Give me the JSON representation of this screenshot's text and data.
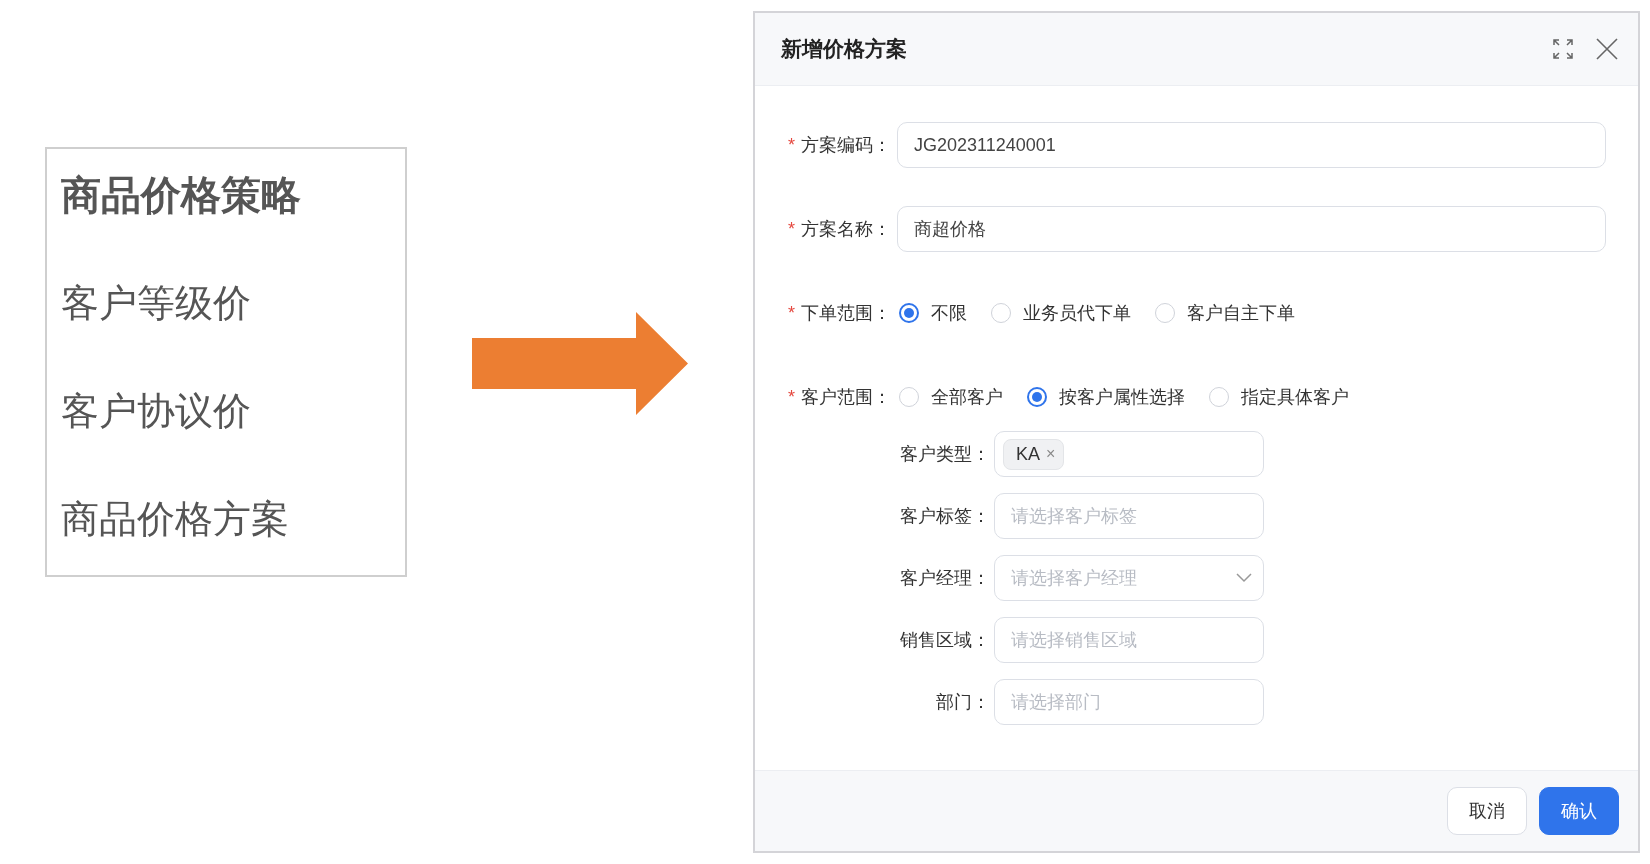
{
  "strategy_panel": {
    "title": "商品价格策略",
    "items": [
      "客户等级价",
      "客户协议价",
      "商品价格方案"
    ]
  },
  "dialog": {
    "title": "新增价格方案",
    "fields": [
      {
        "kind": "text",
        "required_mark": "*",
        "label": "方案编码：",
        "value": "JG202311240001"
      },
      {
        "kind": "text",
        "required_mark": "*",
        "label": "方案名称：",
        "value": "商超价格"
      },
      {
        "kind": "radio",
        "required_mark": "*",
        "label": "下单范围：",
        "options": [
          {
            "label": "不限",
            "selected": true
          },
          {
            "label": "业务员代下单",
            "selected": false
          },
          {
            "label": "客户自主下单",
            "selected": false
          }
        ]
      },
      {
        "kind": "radio",
        "required_mark": "*",
        "label": "客户范围：",
        "options": [
          {
            "label": "全部客户",
            "selected": false
          },
          {
            "label": "按客户属性选择",
            "selected": true
          },
          {
            "label": "指定具体客户",
            "selected": false
          }
        ]
      }
    ],
    "sub_fields": [
      {
        "kind": "tags",
        "label": "客户类型：",
        "tags": [
          {
            "label": "KA",
            "remove": "×"
          }
        ]
      },
      {
        "kind": "input",
        "label": "客户标签：",
        "placeholder": "请选择客户标签"
      },
      {
        "kind": "select",
        "label": "客户经理：",
        "placeholder": "请选择客户经理"
      },
      {
        "kind": "input",
        "label": "销售区域：",
        "placeholder": "请选择销售区域"
      },
      {
        "kind": "input",
        "label": "部门：",
        "placeholder": "请选择部门"
      }
    ],
    "buttons": [
      {
        "kind": "default",
        "label": "取消"
      },
      {
        "kind": "primary",
        "label": "确认"
      }
    ]
  }
}
